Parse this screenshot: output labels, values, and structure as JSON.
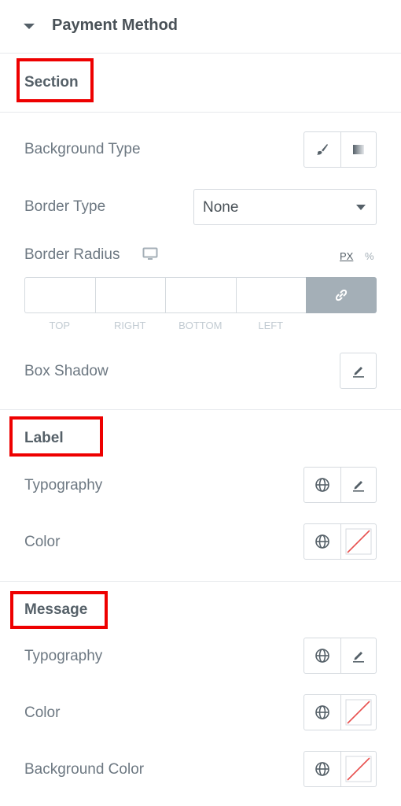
{
  "panel": {
    "title": "Payment Method"
  },
  "sections": {
    "section": {
      "heading": "Section"
    },
    "label": {
      "heading": "Label"
    },
    "message": {
      "heading": "Message"
    }
  },
  "controls": {
    "background_type": "Background Type",
    "border_type": "Border Type",
    "border_type_value": "None",
    "border_radius": "Border Radius",
    "units": [
      "PX",
      "%"
    ],
    "dimension_labels": [
      "TOP",
      "RIGHT",
      "BOTTOM",
      "LEFT"
    ],
    "box_shadow": "Box Shadow",
    "label_typography": "Typography",
    "label_color": "Color",
    "message_typography": "Typography",
    "message_color": "Color",
    "message_background_color": "Background Color"
  },
  "icons": {
    "collapse": "caret-down-icon",
    "classic_background": "paint-brush-icon",
    "gradient_background": "gradient-icon",
    "responsive": "desktop-icon",
    "link": "link-icon",
    "edit": "pencil-icon",
    "global": "globe-icon",
    "no_color": "empty-color-swatch-icon"
  },
  "colors": {
    "highlight": "#ee0000",
    "link_button": "#a4afb7",
    "swatch_slash": "#e8514f"
  }
}
